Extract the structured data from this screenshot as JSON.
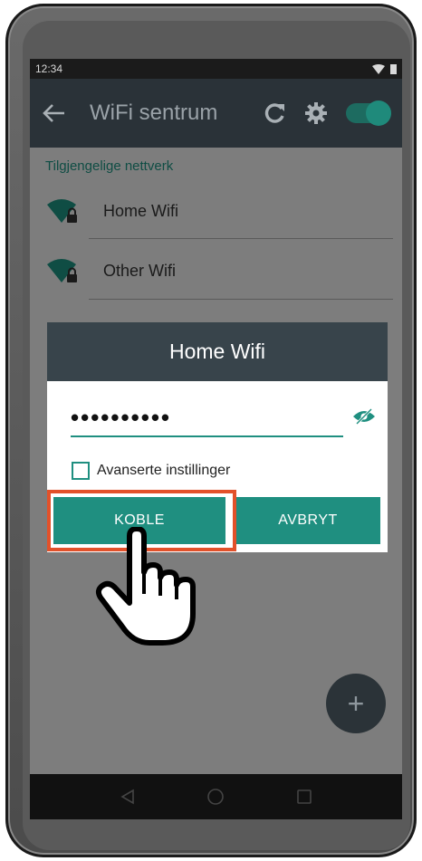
{
  "status_bar": {
    "time": "12:34"
  },
  "app_bar": {
    "title": "WiFi sentrum",
    "back_icon": "arrow-left-icon",
    "refresh_icon": "refresh-icon",
    "settings_icon": "gear-icon",
    "wifi_toggle_on": true
  },
  "networks": {
    "section_label": "Tilgjengelige nettverk",
    "items": [
      {
        "name": "Home Wifi",
        "icon": "locked-wifi-icon"
      },
      {
        "name": "Other Wifi",
        "icon": "locked-wifi-icon"
      }
    ]
  },
  "dialog": {
    "title": "Home Wifi",
    "password_value": "••••••••••",
    "toggle_visibility_icon": "eye-off-icon",
    "advanced_label": "Avanserte instillinger",
    "advanced_checked": false,
    "connect_label": "KOBLE",
    "cancel_label": "AVBRYT"
  },
  "fab": {
    "label": "+"
  },
  "colors": {
    "accent": "#1f8f80",
    "highlight": "#e2512a",
    "app_bar": "#2a3238",
    "dialog_header": "#38444b"
  }
}
